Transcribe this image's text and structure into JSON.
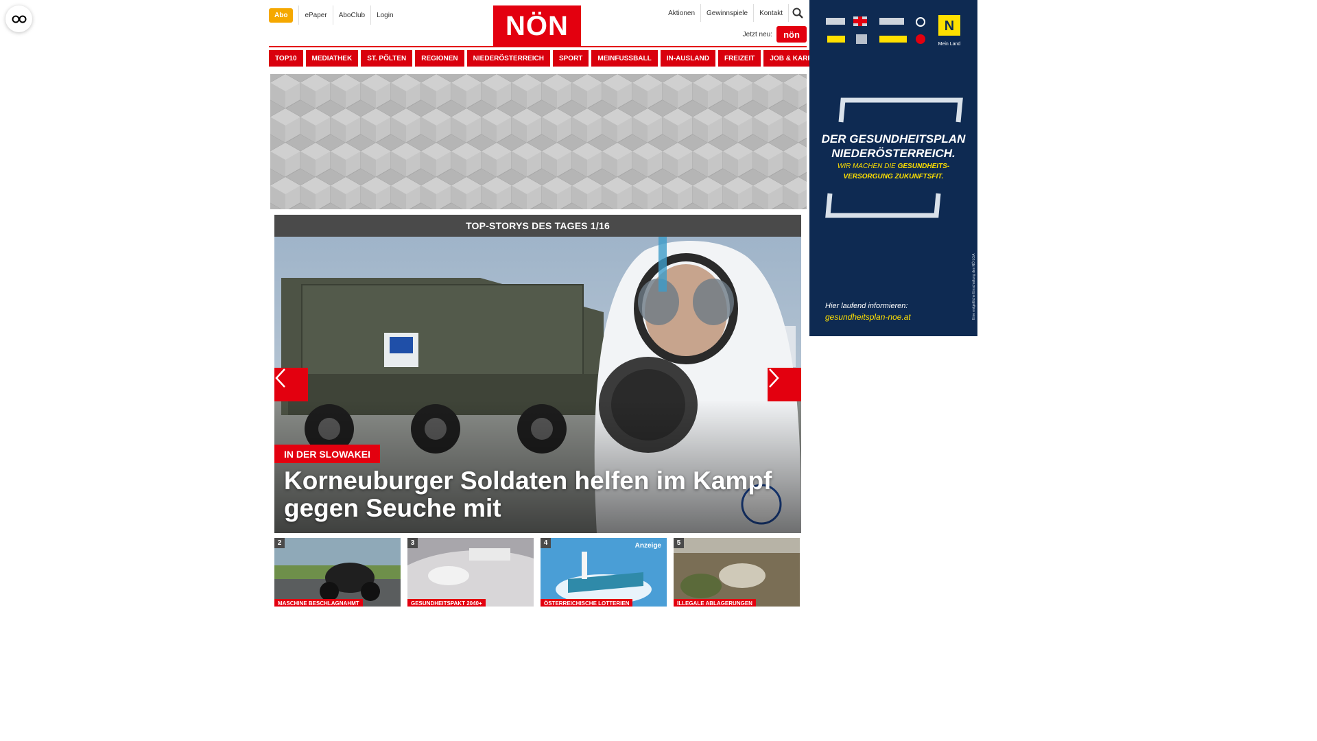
{
  "a11y": {
    "icon": "glasses-icon"
  },
  "header": {
    "abo_label": "Abo",
    "left_links": [
      "ePaper",
      "AboClub",
      "Login"
    ],
    "logo_text": "NÖN",
    "right_links": [
      "Aktionen",
      "Gewinnspiele",
      "Kontakt"
    ],
    "jetzt_neu_label": "Jetzt neu:",
    "app_badge_text": "nön",
    "search_icon": "search-icon"
  },
  "nav": {
    "items": [
      "TOP10",
      "MEDIATHEK",
      "ST. PÖLTEN",
      "REGIONEN",
      "NIEDERÖSTERREICH",
      "SPORT",
      "MEINFUSSBALL",
      "IN-AUSLAND",
      "FREIZEIT",
      "JOB & KARRIERE"
    ]
  },
  "top_stories": {
    "header": "TOP-STORYS DES TAGES 1/16",
    "hero": {
      "kicker": "IN DER SLOWAKEI",
      "title": "Korneuburger Soldaten helfen im Kampf gegen Seuche mit"
    },
    "thumbs": [
      {
        "num": "2",
        "tag": "MASCHINE BESCHLAGNAHMT",
        "ad": ""
      },
      {
        "num": "3",
        "tag": "GESUNDHEITSPAKT 2040+",
        "ad": ""
      },
      {
        "num": "4",
        "tag": "ÖSTERREICHISCHE LOTTERIEN",
        "ad": "Anzeige"
      },
      {
        "num": "5",
        "tag": "ILLEGALE ABLAGERUNGEN",
        "ad": ""
      }
    ]
  },
  "side_ad": {
    "title_line1": "DER GESUNDHEITSPLAN",
    "title_line2": "NIEDERÖSTERREICH.",
    "sub_line1_a": "WIR MACHEN DIE ",
    "sub_line1_b": "GESUNDHEITS-",
    "sub_line2": "VERSORGUNG ZUKUNFTSFIT.",
    "info": "Hier laufend informieren:",
    "url": "gesundheitsplan-noe.at",
    "brand_label": "Mein Land",
    "vertical_note": "Eine entgeltliche Einschaltung des NÖ LGA",
    "colors": {
      "bg": "#0e2a52",
      "accent": "#ffe000"
    }
  },
  "colors": {
    "brand_red": "#e3000f",
    "abo": "#f5a800",
    "dark_header": "#4a4a4a"
  }
}
